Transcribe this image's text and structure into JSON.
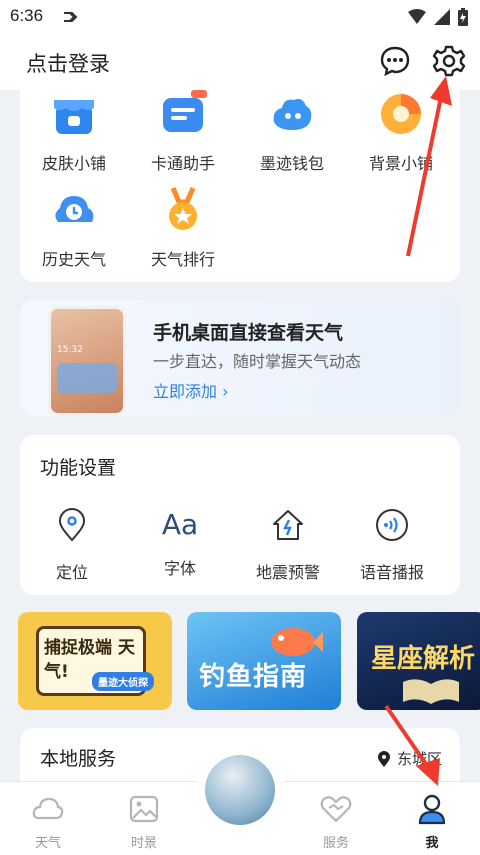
{
  "status": {
    "time": "6:36"
  },
  "header": {
    "login": "点击登录"
  },
  "tools": [
    {
      "label": "皮肤小铺",
      "icon": "shop-icon"
    },
    {
      "label": "卡通助手",
      "icon": "cartoon-assistant-icon"
    },
    {
      "label": "墨迹钱包",
      "icon": "wallet-icon"
    },
    {
      "label": "背景小铺",
      "icon": "background-shop-icon"
    },
    {
      "label": "历史天气",
      "icon": "history-weather-icon"
    },
    {
      "label": "天气排行",
      "icon": "weather-rank-icon"
    }
  ],
  "banner": {
    "title": "手机桌面直接查看天气",
    "subtitle": "一步直达，随时掌握天气动态",
    "link": "立即添加",
    "phone_time": "15:32"
  },
  "functions": {
    "title": "功能设置",
    "items": [
      {
        "label": "定位",
        "icon": "location-icon"
      },
      {
        "label": "字体",
        "icon": "font-icon"
      },
      {
        "label": "地震预警",
        "icon": "earthquake-icon"
      },
      {
        "label": "语音播报",
        "icon": "voice-broadcast-icon"
      }
    ]
  },
  "promos": [
    {
      "title": "捕捉极端 天气!",
      "tag": "墨迹大侦探"
    },
    {
      "title": "钓鱼指南"
    },
    {
      "title": "星座解析"
    }
  ],
  "local": {
    "title": "本地服务",
    "location": "东城区"
  },
  "tabs": [
    {
      "label": "天气",
      "icon": "cloud-icon"
    },
    {
      "label": "时景",
      "icon": "picture-icon"
    },
    {
      "label": "服务",
      "icon": "service-icon"
    },
    {
      "label": "我",
      "icon": "profile-icon"
    }
  ],
  "colors": {
    "accent": "#2f7fe6",
    "arrow": "#ef3b2d"
  }
}
